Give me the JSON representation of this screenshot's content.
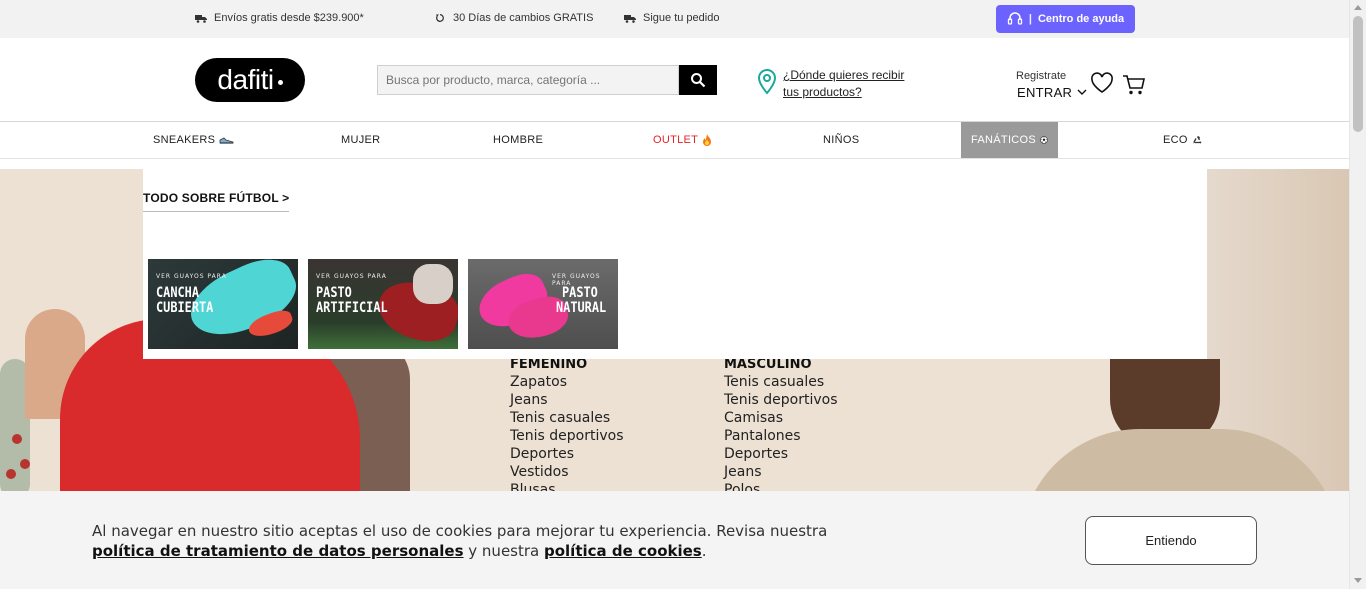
{
  "topbar": {
    "shipping": "Envíos gratis desde $239.900*",
    "returns": "30 Días de cambios GRATIS",
    "tracking": "Sigue tu pedido",
    "help": "Centro de ayuda",
    "help_separator": "|"
  },
  "header": {
    "logo": "dafiti",
    "search_placeholder": "Busca por producto, marca, categoría ...",
    "location": "¿Dónde quieres recibir tus productos?",
    "register": "Registrate",
    "login": "ENTRAR"
  },
  "nav": {
    "items": [
      "SNEAKERS",
      "MUJER",
      "HOMBRE",
      "OUTLET",
      "NIÑOS",
      "FANÁTICOS",
      "ECO"
    ]
  },
  "dropdown": {
    "title": "TODO SOBRE FÚTBOL >",
    "tiles": [
      {
        "kicker": "VER GUAYOS PARA",
        "line1": "CANCHA",
        "line2": "CUBIERTA"
      },
      {
        "kicker": "VER GUAYOS PARA",
        "line1": "PASTO",
        "line2": "ARTIFICIAL"
      },
      {
        "kicker": "VER GUAYOS PARA",
        "line1": "PASTO",
        "line2": "NATURAL"
      }
    ]
  },
  "categories": {
    "femenino": {
      "title": "FEMENINO",
      "links": [
        "Zapatos",
        "Jeans",
        "Tenis casuales",
        "Tenis deportivos",
        "Deportes",
        "Vestidos",
        "Blusas"
      ]
    },
    "masculino": {
      "title": "MASCULINO",
      "links": [
        "Tenis casuales",
        "Tenis deportivos",
        "Camisas",
        "Pantalones",
        "Deportes",
        "Jeans",
        "Polos"
      ]
    }
  },
  "cookie": {
    "text_before": "Al navegar en nuestro sitio aceptas el uso de cookies para mejorar tu experiencia. Revisa nuestra ",
    "policy_link": "política de tratamiento de datos personales",
    "text_middle": " y nuestra ",
    "cookies_link": "política de cookies",
    "text_after": ".",
    "accept": "Entiendo"
  },
  "colors": {
    "help_button": "#6c63ff",
    "outlet": "#e5242b",
    "active_nav": "#9a9a9a",
    "location_icon": "#1aa89b"
  }
}
